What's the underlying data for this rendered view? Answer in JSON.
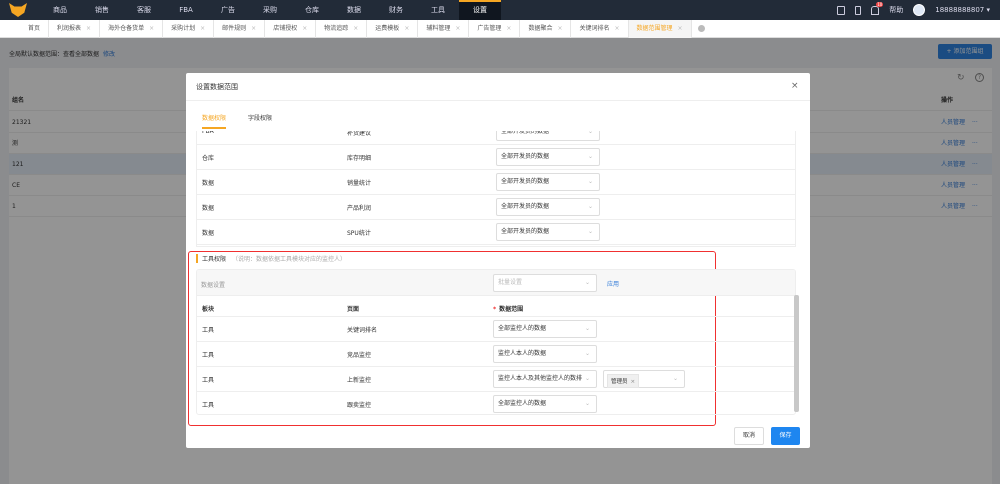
{
  "nav": {
    "items": [
      "商品",
      "销售",
      "客服",
      "FBA",
      "广告",
      "采购",
      "仓库",
      "数据",
      "财务",
      "工具",
      "设置"
    ],
    "active": "设置",
    "help": "帮助",
    "notification_count": "10",
    "user": "18888888807"
  },
  "tabs": {
    "items": [
      "首页",
      "利润报表",
      "海外仓备货单",
      "采购计划",
      "邮件规则",
      "店铺授权",
      "物流追踪",
      "运费模板",
      "辅料管理",
      "广告管理",
      "数据聚合",
      "关键词排名",
      "数据范围管理"
    ],
    "active": "数据范围管理"
  },
  "page": {
    "global_label": "全局默认数据范围：查看全部数据",
    "edit_link": "修改",
    "add_button": "+ 添加范围组",
    "col_name": "组名",
    "col_ops": "操作",
    "rows": [
      "21321",
      "测",
      "121",
      "CE",
      "1"
    ],
    "row_action": "人员管理",
    "more": "···"
  },
  "modal": {
    "title": "设置数据范围",
    "tabs": [
      "数据权限",
      "字段权限"
    ],
    "active_tab": "数据权限",
    "upper_rows": [
      {
        "module": "FBA",
        "page": "补货建议",
        "scope": "全部开发员的数据"
      },
      {
        "module": "仓库",
        "page": "库存明细",
        "scope": "全部开发员的数据"
      },
      {
        "module": "数据",
        "page": "销量统计",
        "scope": "全部开发员的数据"
      },
      {
        "module": "数据",
        "page": "产品利润",
        "scope": "全部开发员的数据"
      },
      {
        "module": "数据",
        "page": "SPU统计",
        "scope": "全部开发员的数据"
      }
    ],
    "tools": {
      "title": "工具权限",
      "note": "（说明：数据依据工具模块对应的监控人）",
      "batch_label": "数据设置",
      "batch_placeholder": "批量设置",
      "apply": "应用",
      "headers": [
        "板块",
        "页面",
        "数据范围"
      ],
      "rows": [
        {
          "module": "工具",
          "page": "关键词排名",
          "scope": "全部监控人的数据"
        },
        {
          "module": "工具",
          "page": "竞品监控",
          "scope": "监控人本人的数据"
        },
        {
          "module": "工具",
          "page": "上新监控",
          "scope": "监控人本人及其他监控人的数排",
          "tag": "管理员"
        },
        {
          "module": "工具",
          "page": "跟卖监控",
          "scope": "全部监控人的数据"
        }
      ]
    },
    "cancel": "取消",
    "save": "保存"
  },
  "colors": {
    "accent": "#f5a623",
    "primary": "#1e86f0",
    "highlight": "#f03030"
  }
}
